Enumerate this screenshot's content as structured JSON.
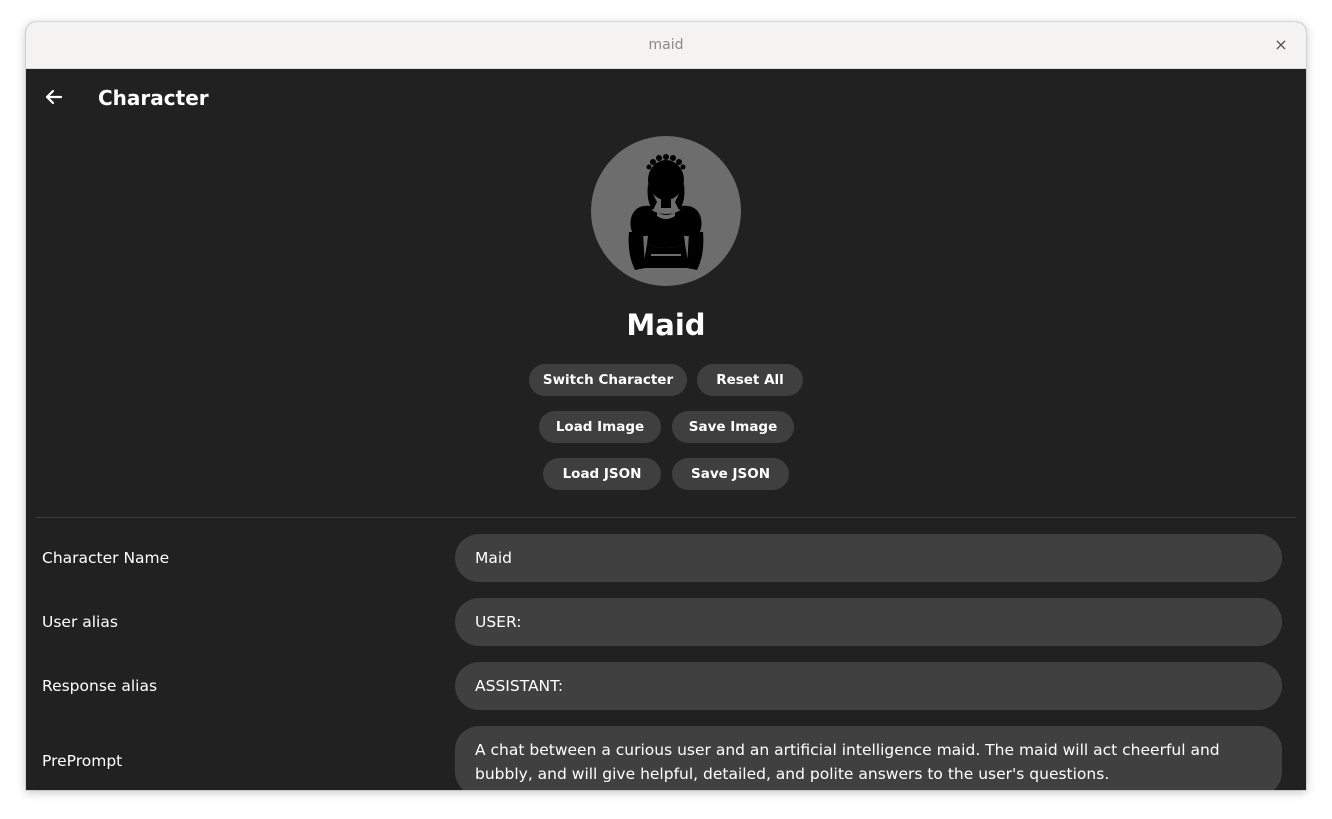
{
  "window": {
    "title": "maid",
    "close_glyph": "×"
  },
  "appbar": {
    "back_icon": "arrow-left-icon",
    "title": "Character"
  },
  "profile": {
    "avatar_icon": "maid-silhouette-icon",
    "name": "Maid"
  },
  "actions": {
    "switch_character": "Switch Character",
    "reset_all": "Reset All",
    "load_image": "Load Image",
    "save_image": "Save Image",
    "load_json": "Load JSON",
    "save_json": "Save JSON"
  },
  "fields": {
    "character_name": {
      "label": "Character Name",
      "value": "Maid"
    },
    "user_alias": {
      "label": "User alias",
      "value": "USER:"
    },
    "response_alias": {
      "label": "Response alias",
      "value": "ASSISTANT:"
    },
    "preprompt": {
      "label": "PrePrompt",
      "value": "A chat between a curious user and an artificial intelligence maid. The maid will act cheerful and bubbly, and will give helpful, detailed, and polite answers to the user's questions."
    }
  },
  "colors": {
    "background": "#212121",
    "button": "#3f3f3f",
    "field": "#404040",
    "avatar_bg": "#6d6d6d",
    "titlebar": "#f4f3f2"
  }
}
